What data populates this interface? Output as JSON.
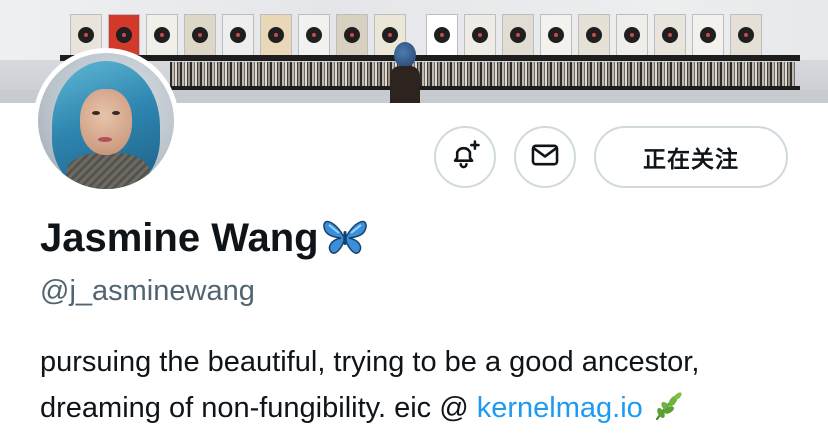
{
  "profile": {
    "display_name": "Jasmine Wang",
    "handle": "@j_asminewang",
    "bio_text": "pursuing the beautiful, trying to be a good ancestor, dreaming of non-fungibility. eic @ ",
    "bio_link": "kernelmag.io",
    "name_emoji": "butterfly-icon",
    "bio_emoji": "herb-icon"
  },
  "actions": {
    "notify_icon": "bell-plus-icon",
    "message_icon": "envelope-icon",
    "follow_label": "正在关注"
  },
  "colors": {
    "text": "#0f1419",
    "secondary": "#536471",
    "link": "#1d9bf0",
    "border": "#cfd9de"
  }
}
